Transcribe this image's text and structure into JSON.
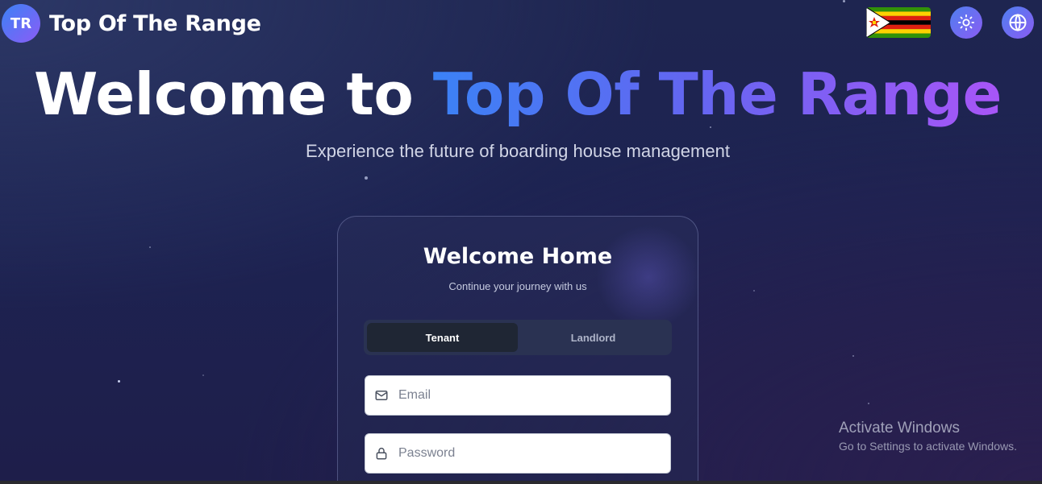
{
  "header": {
    "logo_initials": "TR",
    "brand_name": "Top Of The Range",
    "flag_icon": "zimbabwe-flag-icon",
    "theme_icon": "sun-icon",
    "language_icon": "globe-icon"
  },
  "hero": {
    "title_prefix": "Welcome to ",
    "title_accent": "Top Of The Range",
    "subtitle": "Experience the future of boarding house management"
  },
  "login_card": {
    "title": "Welcome Home",
    "subtitle": "Continue your journey with us",
    "tabs": [
      {
        "label": "Tenant",
        "active": true
      },
      {
        "label": "Landlord",
        "active": false
      }
    ],
    "email": {
      "placeholder": "Email",
      "value": "",
      "icon": "mail-icon"
    },
    "password": {
      "placeholder": "Password",
      "value": "",
      "icon": "lock-icon"
    }
  },
  "watermark": {
    "title": "Activate Windows",
    "subtitle": "Go to Settings to activate Windows."
  },
  "colors": {
    "accent_blue": "#3b82f6",
    "accent_purple": "#a855f7",
    "background": "#1e2550"
  }
}
